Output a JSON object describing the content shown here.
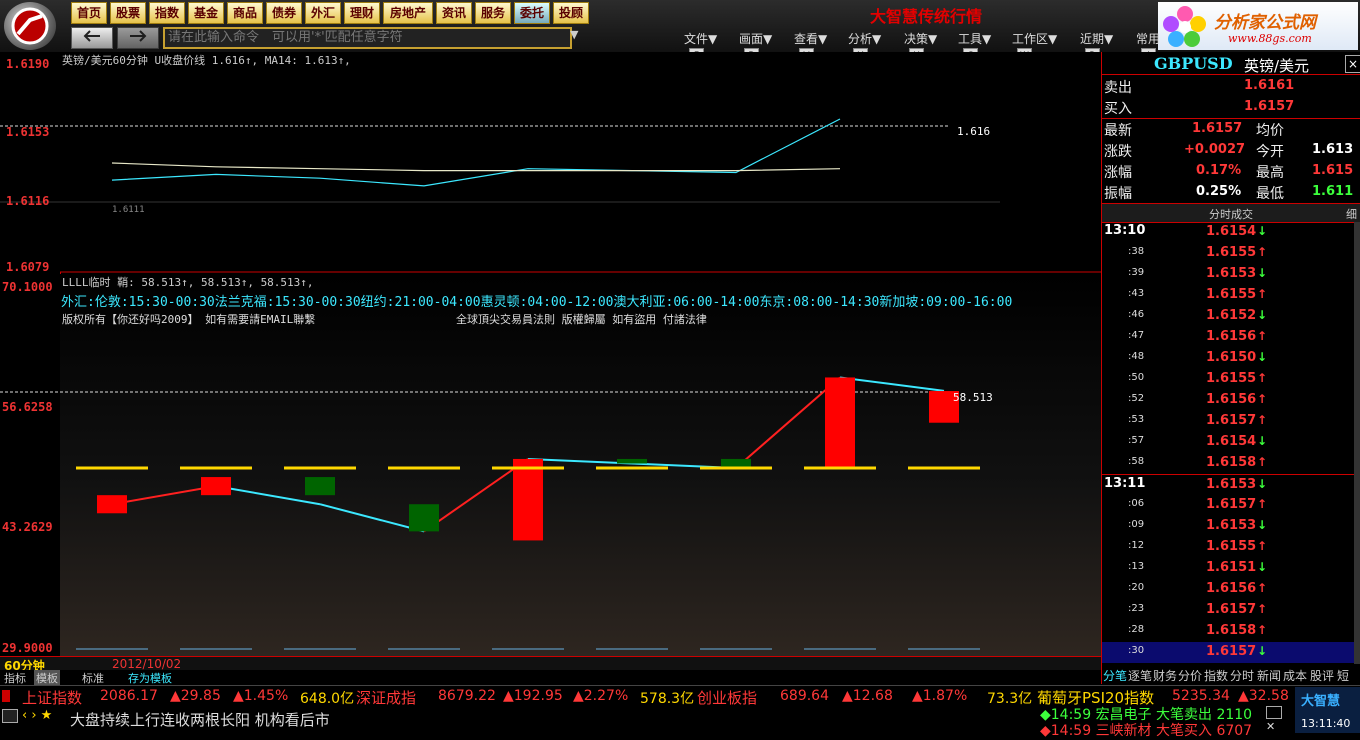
{
  "app": {
    "title": "大智慧传统行情"
  },
  "nav": [
    {
      "label": "首页"
    },
    {
      "label": "股票"
    },
    {
      "label": "指数"
    },
    {
      "label": "基金"
    },
    {
      "label": "商品"
    },
    {
      "label": "债券"
    },
    {
      "label": "外汇"
    },
    {
      "label": "理财"
    },
    {
      "label": "房地产"
    },
    {
      "label": "资讯"
    },
    {
      "label": "服务"
    },
    {
      "label": "委托"
    },
    {
      "label": "投顾"
    }
  ],
  "brand": {
    "name": "分析家公式网",
    "url": "www.88gs.com"
  },
  "command": {
    "placeholder": "请在此输入命令　可以用'*'匹配任意字符"
  },
  "menus": [
    {
      "label": "文件▼",
      "key": "F"
    },
    {
      "label": "画面▼",
      "key": "B"
    },
    {
      "label": "查看▼",
      "key": "V"
    },
    {
      "label": "分析▼",
      "key": "Y"
    },
    {
      "label": "决策▼",
      "key": "U"
    },
    {
      "label": "工具▼",
      "key": "G"
    },
    {
      "label": "工作区▼",
      "key": "W"
    },
    {
      "label": "近期▼",
      "key": "R"
    },
    {
      "label": "常用",
      "key": "J"
    }
  ],
  "top_chart": {
    "header": "英镑/美元60分钟 U收盘价线 1.616↑, MA14: 1.613↑,",
    "y_labels": [
      "1.6190",
      "1.6153",
      "1.6116",
      "1.6079"
    ],
    "last_label": "1.616",
    "low_label": "1.6111"
  },
  "bottom_chart": {
    "header": "LLLL临时 鞘: 58.513↑, 58.513↑, 58.513↑,",
    "sessions": "外汇:伦敦:15:30-00:30法兰克福:15:30-00:30纽约:21:00-04:00惠灵顿:04:00-12:00澳大利亚:06:00-14:00东京:08:00-14:30新加坡:09:00-16:00",
    "copyright": "版权所有【你还好吗2009】 如有需要請EMAIL聯繫",
    "law": "全球頂尖交易員法則 版權歸屬 如有盜用 付諸法律",
    "y_labels": [
      "70.1000",
      "56.6258",
      "43.2629",
      "29.9000"
    ],
    "last_label": "58.513"
  },
  "chart_data": [
    {
      "type": "line",
      "x": [
        1,
        2,
        3,
        4,
        5,
        6,
        7,
        8
      ],
      "series": [
        {
          "name": "U收盘价线",
          "values": [
            1.6125,
            1.6128,
            1.6126,
            1.6122,
            1.6131,
            1.613,
            1.6129,
            1.6157
          ]
        },
        {
          "name": "MA14",
          "values": [
            1.6134,
            1.6132,
            1.6131,
            1.613,
            1.613,
            1.613,
            1.613,
            1.6131
          ]
        }
      ],
      "ylim": [
        1.6079,
        1.619
      ]
    },
    {
      "type": "bar",
      "x": [
        1,
        2,
        3,
        4,
        5,
        6,
        7,
        8,
        9
      ],
      "open": [
        45.0,
        47.0,
        49.0,
        46.0,
        42.0,
        51.0,
        51.0,
        50.0,
        55.0
      ],
      "close": [
        47.0,
        49.0,
        47.0,
        43.0,
        51.0,
        50.5,
        50.0,
        60.0,
        58.5
      ],
      "line": [
        46.0,
        48.0,
        46.0,
        43.0,
        51.0,
        50.5,
        50.0,
        60.0,
        58.513
      ],
      "ylim": [
        29.9,
        70.1
      ]
    }
  ],
  "timeframe": {
    "label": "60分钟",
    "date": "2012/10/02"
  },
  "tabs": [
    {
      "label": "指标"
    },
    {
      "label": "模板"
    },
    {
      "label": "标准"
    },
    {
      "label": "存为模板"
    }
  ],
  "quote": {
    "code": "GBPUSD",
    "name": "英镑/美元",
    "sell_label": "卖出",
    "sell": "1.6161",
    "buy_label": "买入",
    "buy": "1.6157",
    "latest_label": "最新",
    "latest": "1.6157",
    "avg_label": "均价",
    "change_label": "涨跌",
    "change": "+0.0027",
    "open_label": "今开",
    "open": "1.613",
    "pct_label": "涨幅",
    "pct": "0.17%",
    "high_label": "最高",
    "high": "1.615",
    "amp_label": "振幅",
    "amp": "0.25%",
    "low_label": "最低",
    "low": "1.611",
    "ticks_title": "分时成交",
    "ticks_side": "细"
  },
  "ticks": [
    {
      "t": "13:10",
      "p": "1.6154",
      "d": "↓"
    },
    {
      "t": ":38",
      "p": "1.6155",
      "d": "↑"
    },
    {
      "t": ":39",
      "p": "1.6153",
      "d": "↓"
    },
    {
      "t": ":43",
      "p": "1.6155",
      "d": "↑"
    },
    {
      "t": ":46",
      "p": "1.6152",
      "d": "↓"
    },
    {
      "t": ":47",
      "p": "1.6156",
      "d": "↑"
    },
    {
      "t": ":48",
      "p": "1.6150",
      "d": "↓"
    },
    {
      "t": ":50",
      "p": "1.6155",
      "d": "↑"
    },
    {
      "t": ":52",
      "p": "1.6156",
      "d": "↑"
    },
    {
      "t": ":53",
      "p": "1.6157",
      "d": "↑"
    },
    {
      "t": ":57",
      "p": "1.6154",
      "d": "↓"
    },
    {
      "t": ":58",
      "p": "1.6158",
      "d": "↑"
    },
    {
      "t": "13:11",
      "p": "1.6153",
      "d": "↓"
    },
    {
      "t": ":06",
      "p": "1.6157",
      "d": "↑"
    },
    {
      "t": ":09",
      "p": "1.6153",
      "d": "↓"
    },
    {
      "t": ":12",
      "p": "1.6155",
      "d": "↑"
    },
    {
      "t": ":13",
      "p": "1.6151",
      "d": "↓"
    },
    {
      "t": ":20",
      "p": "1.6156",
      "d": "↑"
    },
    {
      "t": ":23",
      "p": "1.6157",
      "d": "↑"
    },
    {
      "t": ":28",
      "p": "1.6158",
      "d": "↑"
    },
    {
      "t": ":30",
      "p": "1.6157",
      "d": "↓"
    }
  ],
  "right_tabs": [
    {
      "label": "分笔"
    },
    {
      "label": "逐笔"
    },
    {
      "label": "财务"
    },
    {
      "label": "分价"
    },
    {
      "label": "指数"
    },
    {
      "label": "分时"
    },
    {
      "label": "新闻"
    },
    {
      "label": "成本"
    },
    {
      "label": "股评"
    },
    {
      "label": "短线"
    }
  ],
  "ticker": {
    "sh_name": "上证指数",
    "sh_val": "2086.17",
    "sh_chg": "▲29.85",
    "sh_pct": "▲1.45%",
    "sh_amt": "648.0亿",
    "sz_name": "深证成指",
    "sz_val": "8679.22",
    "sz_chg": "▲192.95",
    "sz_pct": "▲2.27%",
    "sz_amt": "578.3亿",
    "cy_name": "创业板指",
    "cy_val": "689.64",
    "cy_chg": "▲12.68",
    "cy_pct": "▲1.87%",
    "cy_amt": "73.3亿",
    "pt_name": "葡萄牙PSI20指数",
    "pt_val": "5235.34",
    "pt_chg": "▲32.58"
  },
  "news": {
    "headline": "大盘持续上行连收两根长阳 机构看后市",
    "alert1": "◆14:59 宏昌电子 大笔卖出 2110",
    "alert2": "◆14:59 三峡新材 大笔买入 6707",
    "clock": "13:11:40",
    "logo": "大智慧"
  },
  "colors": {
    "up": "#ff0000",
    "down": "#006400",
    "accent": "#ffd800",
    "cyan": "#3ce8ff"
  }
}
